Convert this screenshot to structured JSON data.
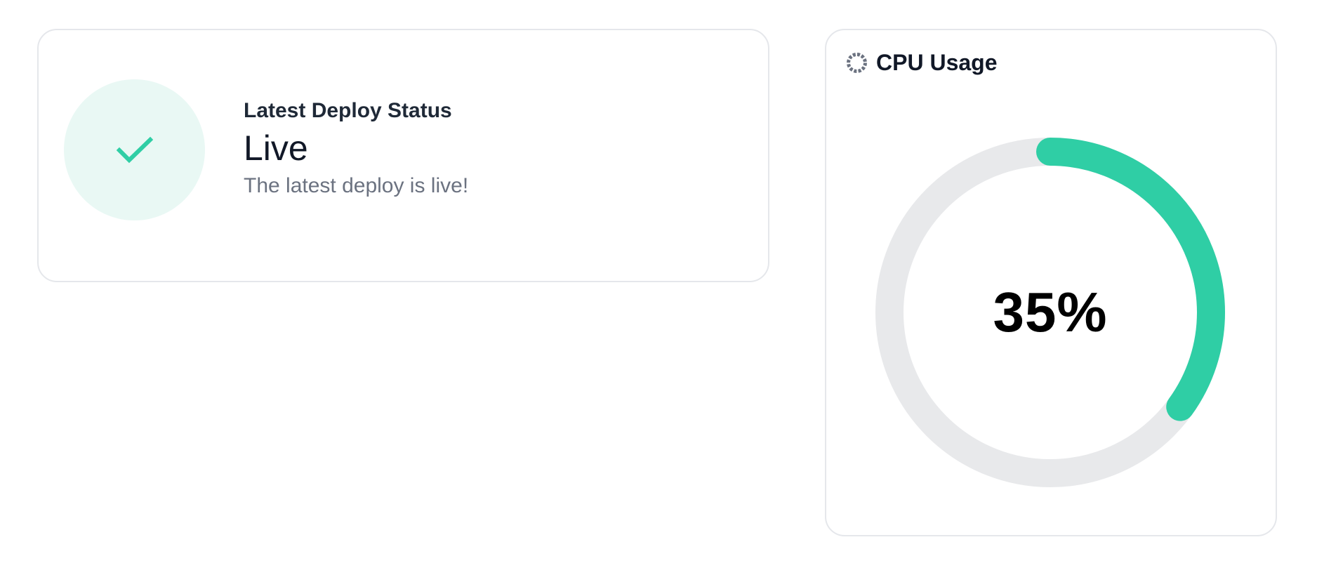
{
  "deploy_card": {
    "icon": "check-icon",
    "heading": "Latest Deploy Status",
    "status": "Live",
    "description": "The latest deploy is live!"
  },
  "cpu_card": {
    "icon": "loading-ring-icon",
    "title": "CPU Usage",
    "value_label": "35%",
    "value": 35
  },
  "colors": {
    "accent": "#2fcea5",
    "accent_soft": "#e9f8f4",
    "track": "#e8e9eb",
    "border": "#e5e7eb",
    "muted_text": "#6b7280",
    "title_text": "#1f2937"
  }
}
